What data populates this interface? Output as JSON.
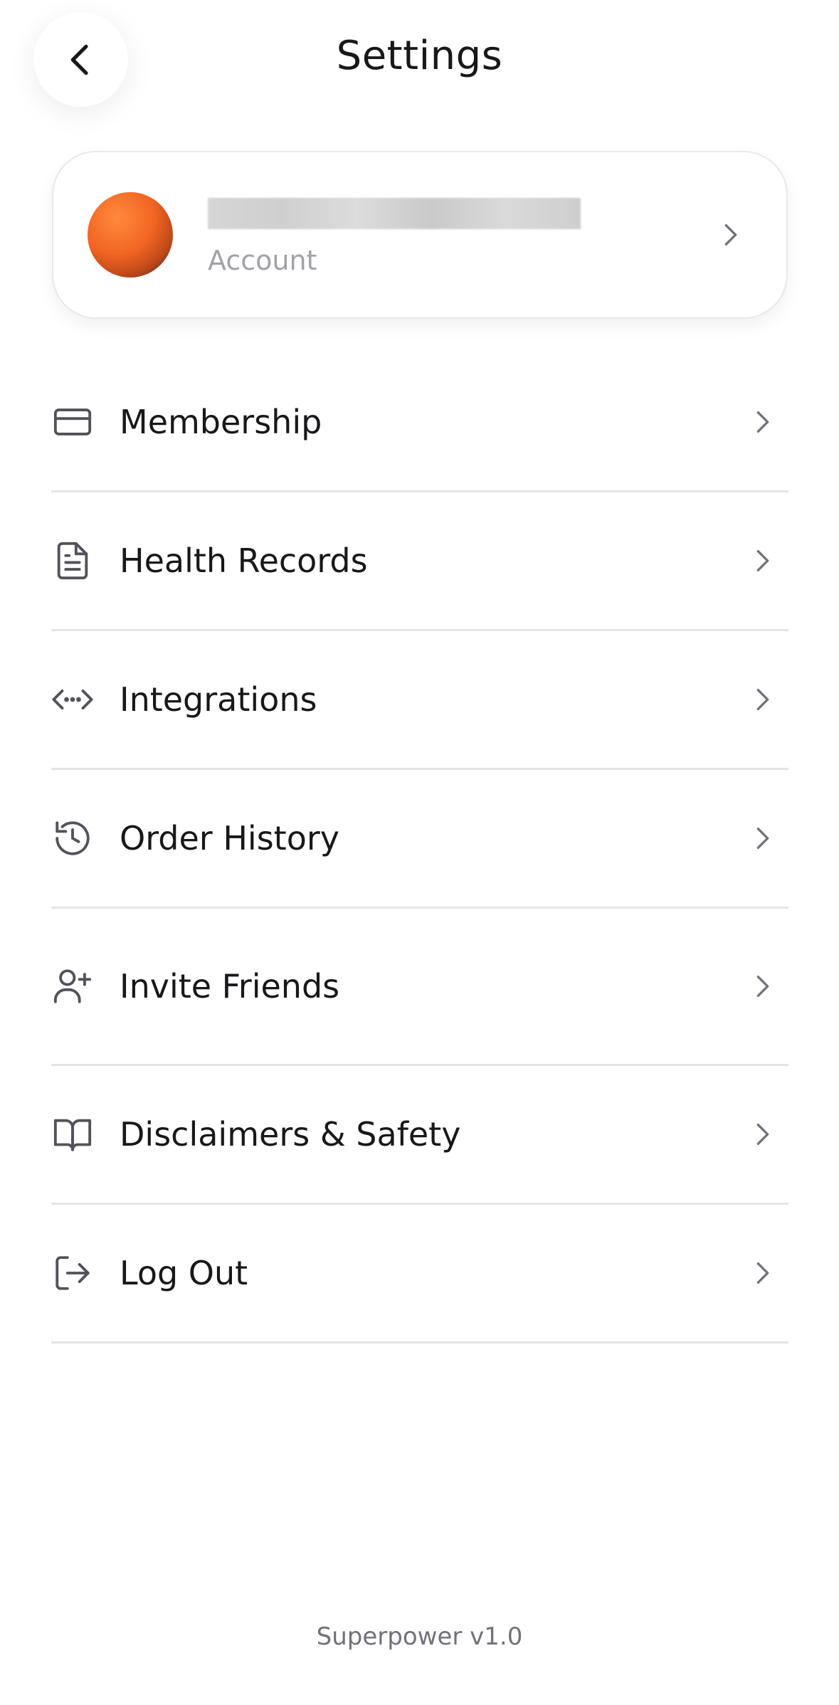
{
  "header": {
    "title": "Settings",
    "back_icon": "chevron-left-icon"
  },
  "account": {
    "name": "",
    "label": "Account",
    "chevron_icon": "chevron-right-icon"
  },
  "menu": {
    "items": [
      {
        "label": "Membership",
        "icon": "credit-card-icon"
      },
      {
        "label": "Health Records",
        "icon": "file-text-icon"
      },
      {
        "label": "Integrations",
        "icon": "code-arrows-icon"
      },
      {
        "label": "Order History",
        "icon": "history-icon"
      },
      {
        "label": "Invite Friends",
        "icon": "user-plus-icon"
      },
      {
        "label": "Disclaimers & Safety",
        "icon": "book-open-icon"
      },
      {
        "label": "Log Out",
        "icon": "log-out-icon"
      }
    ]
  },
  "footer": {
    "version": "Superpower v1.0"
  },
  "colors": {
    "text": "#18181b",
    "muted": "#a1a1aa",
    "divider": "#e4e4e7",
    "icon": "#52525b",
    "avatar_accent": "#f26522"
  }
}
